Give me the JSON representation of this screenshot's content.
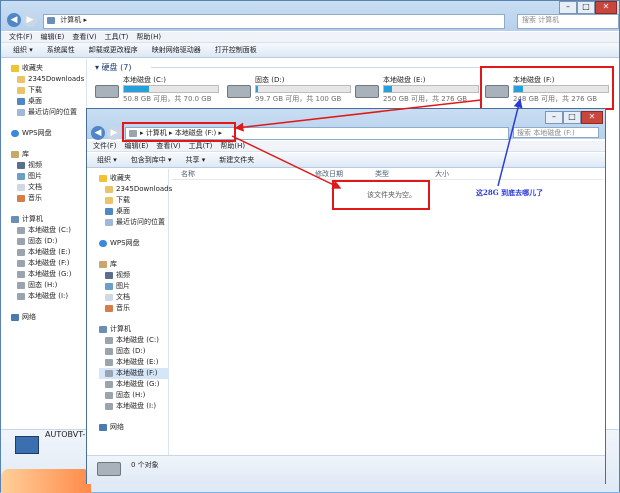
{
  "back_window": {
    "address": {
      "location": "计算机",
      "search_placeholder": "搜索 计算机"
    },
    "menu": [
      "文件(F)",
      "编辑(E)",
      "查看(V)",
      "工具(T)",
      "帮助(H)"
    ],
    "commands": [
      "组织 ▾",
      "系统属性",
      "卸载或更改程序",
      "映射网络驱动器",
      "打开控制面板"
    ],
    "section": "硬盘 (7)",
    "drives": [
      {
        "name": "本地磁盘 (C:)",
        "info": "50.8 GB 可用，共 70.0 GB",
        "used": 0.27
      },
      {
        "name": "固态 (D:)",
        "info": "99.7 GB 可用，共 100 GB",
        "used": 0.003
      },
      {
        "name": "本地磁盘 (E:)",
        "info": "250 GB 可用，共 276 GB",
        "used": 0.09
      },
      {
        "name": "本地磁盘 (F:)",
        "info": "248 GB 可用，共 276 GB",
        "used": 0.1
      }
    ],
    "nav": [
      {
        "label": "收藏夹",
        "icon": "star-icon"
      },
      {
        "label": "2345Downloads",
        "icon": "folder-icon"
      },
      {
        "label": "下载",
        "icon": "download-folder-icon"
      },
      {
        "label": "桌面",
        "icon": "desktop-icon"
      },
      {
        "label": "最近访问的位置",
        "icon": "recent-places-icon"
      },
      {
        "label": "WPS网盘",
        "icon": "cloud-drive-icon"
      },
      {
        "label": "库",
        "icon": "library-icon"
      },
      {
        "label": "视频",
        "icon": "video-icon"
      },
      {
        "label": "图片",
        "icon": "picture-icon"
      },
      {
        "label": "文档",
        "icon": "document-icon"
      },
      {
        "label": "音乐",
        "icon": "music-icon"
      },
      {
        "label": "计算机",
        "icon": "computer-icon"
      },
      {
        "label": "本地磁盘 (C:)",
        "icon": "drive-icon"
      },
      {
        "label": "固态 (D:)",
        "icon": "drive-icon"
      },
      {
        "label": "本地磁盘 (E:)",
        "icon": "drive-icon"
      },
      {
        "label": "本地磁盘 (F:)",
        "icon": "drive-icon"
      },
      {
        "label": "本地磁盘 (G:)",
        "icon": "drive-icon"
      },
      {
        "label": "固态 (H:)",
        "icon": "drive-icon"
      },
      {
        "label": "本地磁盘 (I:)",
        "icon": "drive-icon"
      },
      {
        "label": "网络",
        "icon": "network-icon"
      }
    ],
    "footer_name": "AUTOBVT-N"
  },
  "front_window": {
    "address": {
      "root": "计算机",
      "location": "本地磁盘 (F:)",
      "search_placeholder": "搜索 本地磁盘 (F:)"
    },
    "menu": [
      "文件(F)",
      "编辑(E)",
      "查看(V)",
      "工具(T)",
      "帮助(H)"
    ],
    "commands": [
      "组织 ▾",
      "包含到库中 ▾",
      "共享 ▾",
      "新建文件夹"
    ],
    "columns": [
      "名称",
      "修改日期",
      "类型",
      "大小"
    ],
    "empty_text": "该文件夹为空。",
    "status": "0 个对象",
    "nav": [
      {
        "label": "收藏夹",
        "icon": "star-icon"
      },
      {
        "label": "2345Downloads",
        "icon": "folder-icon"
      },
      {
        "label": "下载",
        "icon": "download-folder-icon"
      },
      {
        "label": "桌面",
        "icon": "desktop-icon"
      },
      {
        "label": "最近访问的位置",
        "icon": "recent-places-icon"
      },
      {
        "label": "WPS网盘",
        "icon": "cloud-drive-icon"
      },
      {
        "label": "库",
        "icon": "library-icon"
      },
      {
        "label": "视频",
        "icon": "video-icon"
      },
      {
        "label": "图片",
        "icon": "picture-icon"
      },
      {
        "label": "文档",
        "icon": "document-icon"
      },
      {
        "label": "音乐",
        "icon": "music-icon"
      },
      {
        "label": "计算机",
        "icon": "computer-icon"
      },
      {
        "label": "本地磁盘 (C:)",
        "icon": "drive-icon"
      },
      {
        "label": "固态 (D:)",
        "icon": "drive-icon"
      },
      {
        "label": "本地磁盘 (E:)",
        "icon": "drive-icon"
      },
      {
        "label": "本地磁盘 (F:)",
        "icon": "drive-icon"
      },
      {
        "label": "本地磁盘 (G:)",
        "icon": "drive-icon"
      },
      {
        "label": "固态 (H:)",
        "icon": "drive-icon"
      },
      {
        "label": "本地磁盘 (I:)",
        "icon": "drive-icon"
      },
      {
        "label": "网络",
        "icon": "network-icon"
      }
    ]
  },
  "annotation": {
    "text": "这28G 到底去哪儿了",
    "color": "#2a3bd6"
  },
  "colors": {
    "red": "#e01818",
    "accent": "#26a0da"
  }
}
